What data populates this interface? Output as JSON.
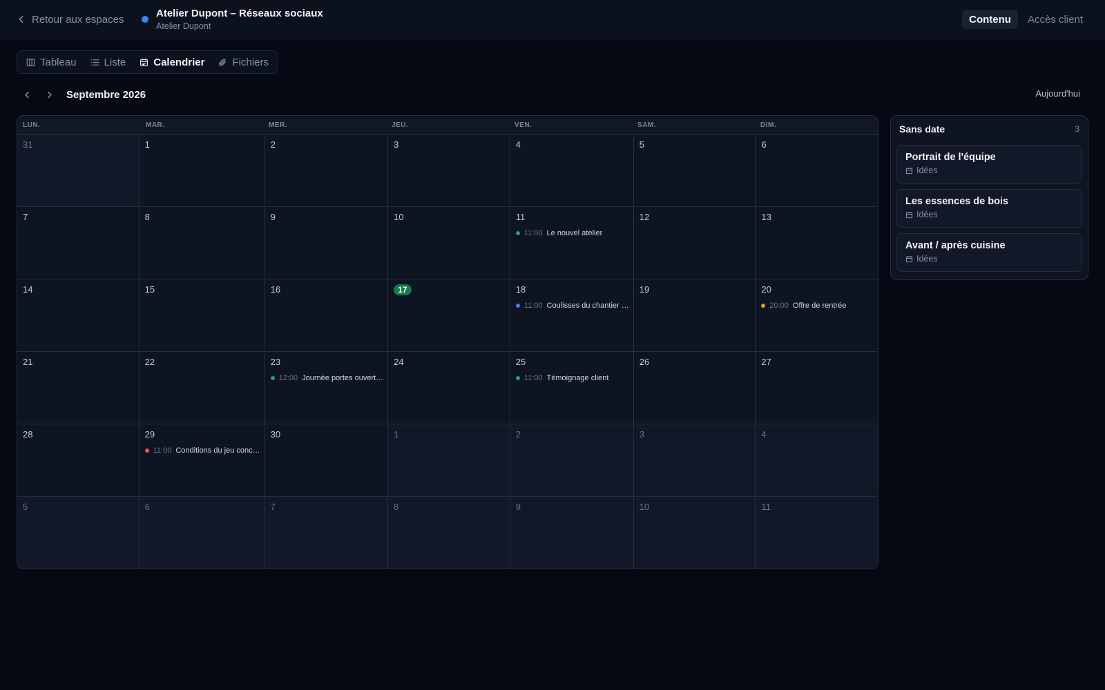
{
  "header": {
    "back_label": "Retour aux espaces",
    "space_title": "Atelier Dupont – Réseaux sociaux",
    "space_subtitle": "Atelier Dupont",
    "space_color": "#3b82f6",
    "tabs": [
      {
        "label": "Contenu",
        "active": true
      },
      {
        "label": "Accès client",
        "active": false
      }
    ]
  },
  "views": [
    {
      "label": "Tableau",
      "icon": "columns-icon",
      "active": false
    },
    {
      "label": "Liste",
      "icon": "list-icon",
      "active": false
    },
    {
      "label": "Calendrier",
      "icon": "calendar-icon",
      "active": true
    },
    {
      "label": "Fichiers",
      "icon": "paperclip-icon",
      "active": false
    }
  ],
  "calendar": {
    "month_label": "Septembre 2026",
    "today_label": "Aujourd'hui",
    "weekdays": [
      "LUN.",
      "MAR.",
      "MER.",
      "JEU.",
      "VEN.",
      "SAM.",
      "DIM."
    ],
    "days": [
      {
        "n": "31",
        "muted": true
      },
      {
        "n": "1"
      },
      {
        "n": "2"
      },
      {
        "n": "3"
      },
      {
        "n": "4"
      },
      {
        "n": "5"
      },
      {
        "n": "6"
      },
      {
        "n": "7"
      },
      {
        "n": "8"
      },
      {
        "n": "9"
      },
      {
        "n": "10"
      },
      {
        "n": "11",
        "events": [
          {
            "time": "11:00",
            "title": "Le nouvel atelier",
            "color": "#22a35a"
          }
        ]
      },
      {
        "n": "12"
      },
      {
        "n": "13"
      },
      {
        "n": "14"
      },
      {
        "n": "15"
      },
      {
        "n": "16"
      },
      {
        "n": "17",
        "today": true
      },
      {
        "n": "18",
        "events": [
          {
            "time": "11:00",
            "title": "Coulisses du chantier …",
            "color": "#3b82f6"
          }
        ]
      },
      {
        "n": "19"
      },
      {
        "n": "20",
        "events": [
          {
            "time": "20:00",
            "title": "Offre de rentrée",
            "color": "#e0a020"
          }
        ]
      },
      {
        "n": "21"
      },
      {
        "n": "22"
      },
      {
        "n": "23",
        "events": [
          {
            "time": "12:00",
            "title": "Journée portes ouvert…",
            "color": "#22a35a"
          }
        ]
      },
      {
        "n": "24"
      },
      {
        "n": "25",
        "events": [
          {
            "time": "11:00",
            "title": "Témoignage client",
            "color": "#22a35a"
          }
        ]
      },
      {
        "n": "26"
      },
      {
        "n": "27"
      },
      {
        "n": "28"
      },
      {
        "n": "29",
        "events": [
          {
            "time": "11:00",
            "title": "Conditions du jeu conc…",
            "color": "#e05a5a"
          }
        ]
      },
      {
        "n": "30"
      },
      {
        "n": "1",
        "muted": true
      },
      {
        "n": "2",
        "muted": true
      },
      {
        "n": "3",
        "muted": true
      },
      {
        "n": "4",
        "muted": true
      },
      {
        "n": "5",
        "muted": true
      },
      {
        "n": "6",
        "muted": true
      },
      {
        "n": "7",
        "muted": true
      },
      {
        "n": "8",
        "muted": true
      },
      {
        "n": "9",
        "muted": true
      },
      {
        "n": "10",
        "muted": true
      },
      {
        "n": "11",
        "muted": true
      }
    ]
  },
  "undated": {
    "title": "Sans date",
    "count": "3",
    "items": [
      {
        "title": "Portrait de l'équipe",
        "status": "Idées"
      },
      {
        "title": "Les essences de bois",
        "status": "Idées"
      },
      {
        "title": "Avant / après cuisine",
        "status": "Idées"
      }
    ]
  }
}
